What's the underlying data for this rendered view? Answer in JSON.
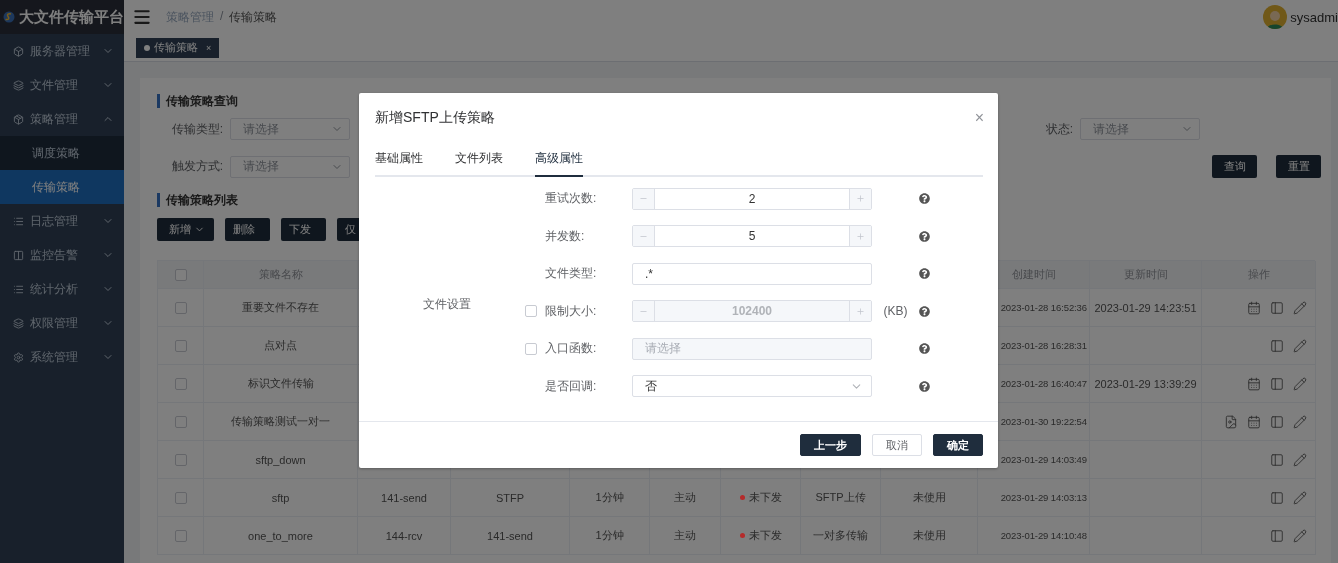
{
  "app": {
    "title": "大文件传输平台",
    "user": "sysadmi"
  },
  "sidebar": {
    "items": [
      {
        "label": "服务器管理",
        "expanded": false,
        "selected": false
      },
      {
        "label": "文件管理",
        "expanded": false,
        "selected": false
      },
      {
        "label": "策略管理",
        "expanded": true,
        "selected": false,
        "children": [
          {
            "label": "调度策略",
            "selected": false
          },
          {
            "label": "传输策略",
            "selected": true
          }
        ]
      },
      {
        "label": "日志管理",
        "expanded": false,
        "selected": false
      },
      {
        "label": "监控告警",
        "expanded": false,
        "selected": false
      },
      {
        "label": "统计分析",
        "expanded": false,
        "selected": false
      },
      {
        "label": "权限管理",
        "expanded": false,
        "selected": false
      },
      {
        "label": "系统管理",
        "expanded": false,
        "selected": false
      }
    ]
  },
  "breadcrumb": {
    "items": [
      "策略管理",
      "传输策略"
    ],
    "separator": "/"
  },
  "tags": [
    {
      "label": "传输策略",
      "close": "×",
      "selected": true
    }
  ],
  "query": {
    "title": "传输策略查询",
    "filters": [
      {
        "label": "传输类型:",
        "placeholder": "请选择"
      },
      {
        "label": "触发方式:",
        "placeholder": "请选择"
      },
      {
        "label": "状态:",
        "placeholder": "请选择"
      }
    ],
    "buttons": [
      "查询",
      "重置"
    ]
  },
  "list": {
    "title": "传输策略列表",
    "toolbar": [
      {
        "label": "新增",
        "dropdown": true
      },
      {
        "label": "删除",
        "dropdown": false
      },
      {
        "label": "下发",
        "dropdown": false
      },
      {
        "label": "仅",
        "dropdown": false
      }
    ]
  },
  "table": {
    "columns": {
      "name": "策略名称",
      "created": "创建时间",
      "updated": "更新时间",
      "actions": "操作"
    },
    "all_checked": false,
    "rows": [
      {
        "checked": false,
        "name": "重要文件不存在",
        "created": "2023-01-28 16:52:36",
        "updated": "2023-01-29 14:23:51",
        "actions": [
          {
            "kind": "schedule"
          },
          {
            "kind": "detail"
          },
          {
            "kind": "edit"
          }
        ]
      },
      {
        "checked": false,
        "name": "点对点",
        "created": "2023-01-28 16:28:31",
        "actions": [
          {
            "kind": "detail"
          },
          {
            "kind": "edit"
          }
        ]
      },
      {
        "checked": false,
        "name": "标识文件传输",
        "created": "2023-01-28 16:40:47",
        "updated": "2023-01-29 13:39:29",
        "actions": [
          {
            "kind": "schedule"
          },
          {
            "kind": "detail"
          },
          {
            "kind": "edit"
          }
        ]
      },
      {
        "checked": false,
        "name": "传输策略测试一对一",
        "created": "2023-01-30 19:22:54",
        "actions": [
          {
            "kind": "report"
          },
          {
            "kind": "schedule"
          },
          {
            "kind": "detail"
          },
          {
            "kind": "edit"
          }
        ]
      },
      {
        "checked": false,
        "name": "sftp_down",
        "created": "2023-01-29 14:03:49",
        "actions": [
          {
            "kind": "detail"
          },
          {
            "kind": "edit"
          }
        ]
      },
      {
        "checked": false,
        "name": "sftp",
        "cells": [
          "141-send",
          "STFP",
          "1分钟",
          "主动",
          {
            "text": "未下发",
            "color": "#b52b2b"
          },
          "SFTP上传",
          "未使用"
        ],
        "created": "2023-01-29 14:03:13",
        "actions": [
          {
            "kind": "detail"
          },
          {
            "kind": "edit"
          }
        ]
      },
      {
        "checked": false,
        "name": "one_to_more",
        "cells": [
          "144-rcv",
          "141-send",
          "1分钟",
          "主动",
          {
            "text": "未下发",
            "color": "#b52b2b"
          },
          "一对多传输",
          "未使用"
        ],
        "created": "2023-01-29 14:10:48",
        "actions": [
          {
            "kind": "detail"
          },
          {
            "kind": "edit"
          }
        ]
      }
    ]
  },
  "dialog": {
    "title": "新增SFTP上传策略",
    "close": "×",
    "tabs": [
      {
        "label": "基础属性",
        "selected": false
      },
      {
        "label": "文件列表",
        "selected": false
      },
      {
        "label": "高级属性",
        "selected": true
      }
    ],
    "section": "文件设置",
    "fields": [
      {
        "kind": "stepper",
        "label": "重试次数:",
        "value": "2",
        "disabled": false
      },
      {
        "kind": "stepper",
        "label": "并发数:",
        "value": "5",
        "disabled": false
      },
      {
        "kind": "text",
        "label": "文件类型:",
        "value": ".*",
        "disabled": false
      },
      {
        "kind": "stepper",
        "label": "限制大小:",
        "value": "102400",
        "disabled": true,
        "checked": false,
        "unit": "(KB)"
      },
      {
        "kind": "select",
        "label": "入口函数:",
        "placeholder": "请选择",
        "disabled": true,
        "checked": false
      },
      {
        "kind": "select",
        "label": "是否回调:",
        "value": "否",
        "disabled": false
      }
    ],
    "buttons": [
      {
        "label": "上一步",
        "primary": true
      },
      {
        "label": "取消",
        "primary": false
      },
      {
        "label": "确定",
        "primary": true
      }
    ]
  }
}
